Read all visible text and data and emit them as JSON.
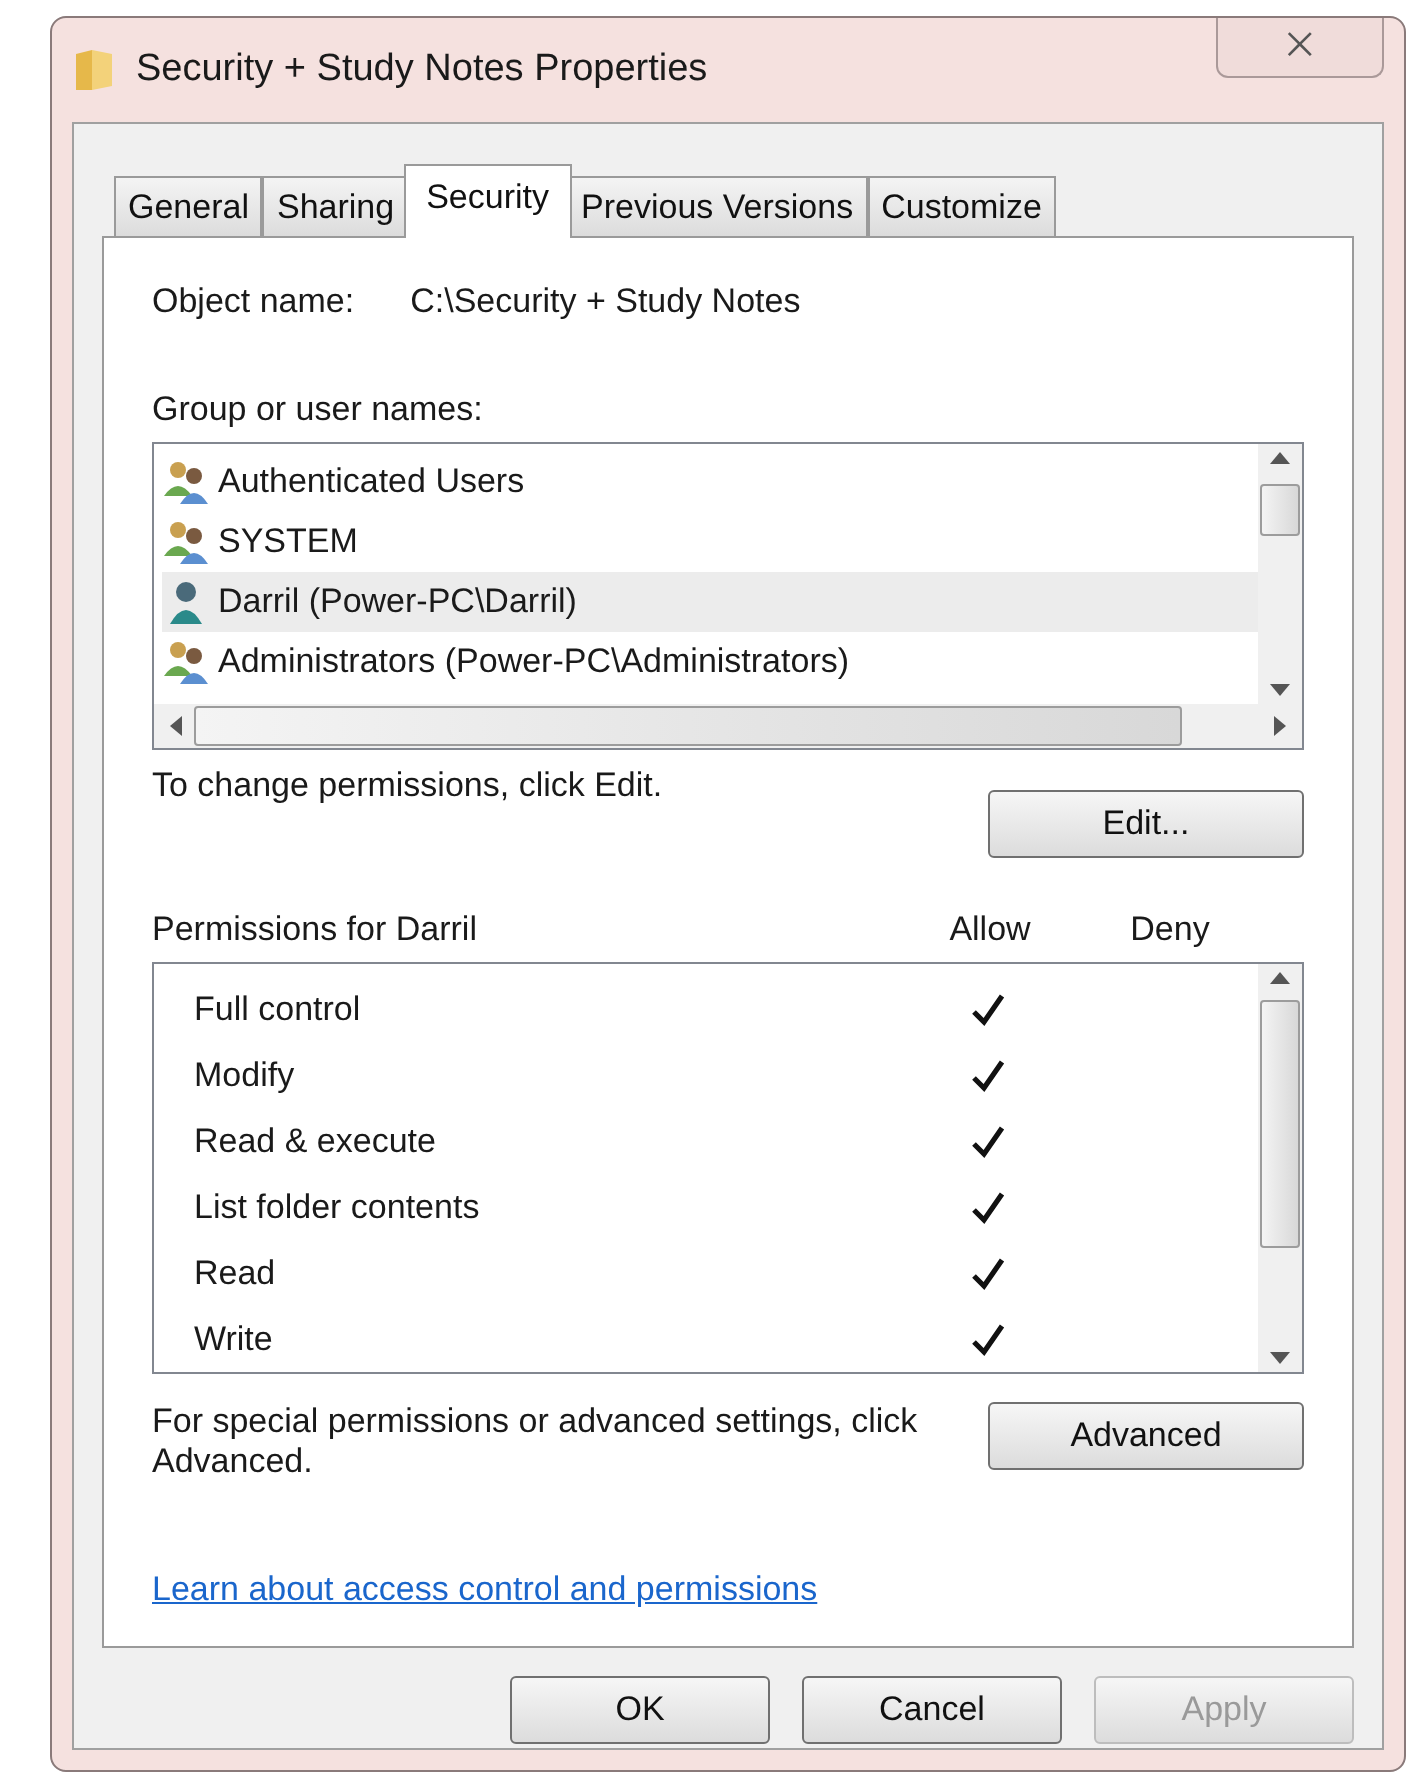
{
  "window": {
    "title": "Security + Study Notes Properties",
    "close": "⨉"
  },
  "tabs": [
    {
      "label": "General",
      "selected": false
    },
    {
      "label": "Sharing",
      "selected": false
    },
    {
      "label": "Security",
      "selected": true
    },
    {
      "label": "Previous Versions",
      "selected": false
    },
    {
      "label": "Customize",
      "selected": false
    }
  ],
  "object": {
    "label": "Object name:",
    "value": "C:\\Security + Study Notes"
  },
  "users": {
    "label": "Group or user names:",
    "items": [
      {
        "name": "Authenticated Users",
        "kind": "group",
        "selected": false
      },
      {
        "name": "SYSTEM",
        "kind": "group",
        "selected": false
      },
      {
        "name": "Darril (Power-PC\\Darril)",
        "kind": "user",
        "selected": true
      },
      {
        "name": "Administrators (Power-PC\\Administrators)",
        "kind": "group",
        "selected": false
      }
    ]
  },
  "edit": {
    "hint": "To change permissions, click Edit.",
    "button": "Edit..."
  },
  "permissions": {
    "title": "Permissions for Darril",
    "allow_header": "Allow",
    "deny_header": "Deny",
    "items": [
      {
        "name": "Full control",
        "allow": true,
        "deny": false
      },
      {
        "name": "Modify",
        "allow": true,
        "deny": false
      },
      {
        "name": "Read & execute",
        "allow": true,
        "deny": false
      },
      {
        "name": "List folder contents",
        "allow": true,
        "deny": false
      },
      {
        "name": "Read",
        "allow": true,
        "deny": false
      },
      {
        "name": "Write",
        "allow": true,
        "deny": false
      }
    ]
  },
  "advanced": {
    "hint": "For special permissions or advanced settings, click Advanced.",
    "button": "Advanced"
  },
  "link": "Learn about access control and permissions",
  "buttons": [
    {
      "label": "OK",
      "disabled": false
    },
    {
      "label": "Cancel",
      "disabled": false
    },
    {
      "label": "Apply",
      "disabled": true
    }
  ]
}
